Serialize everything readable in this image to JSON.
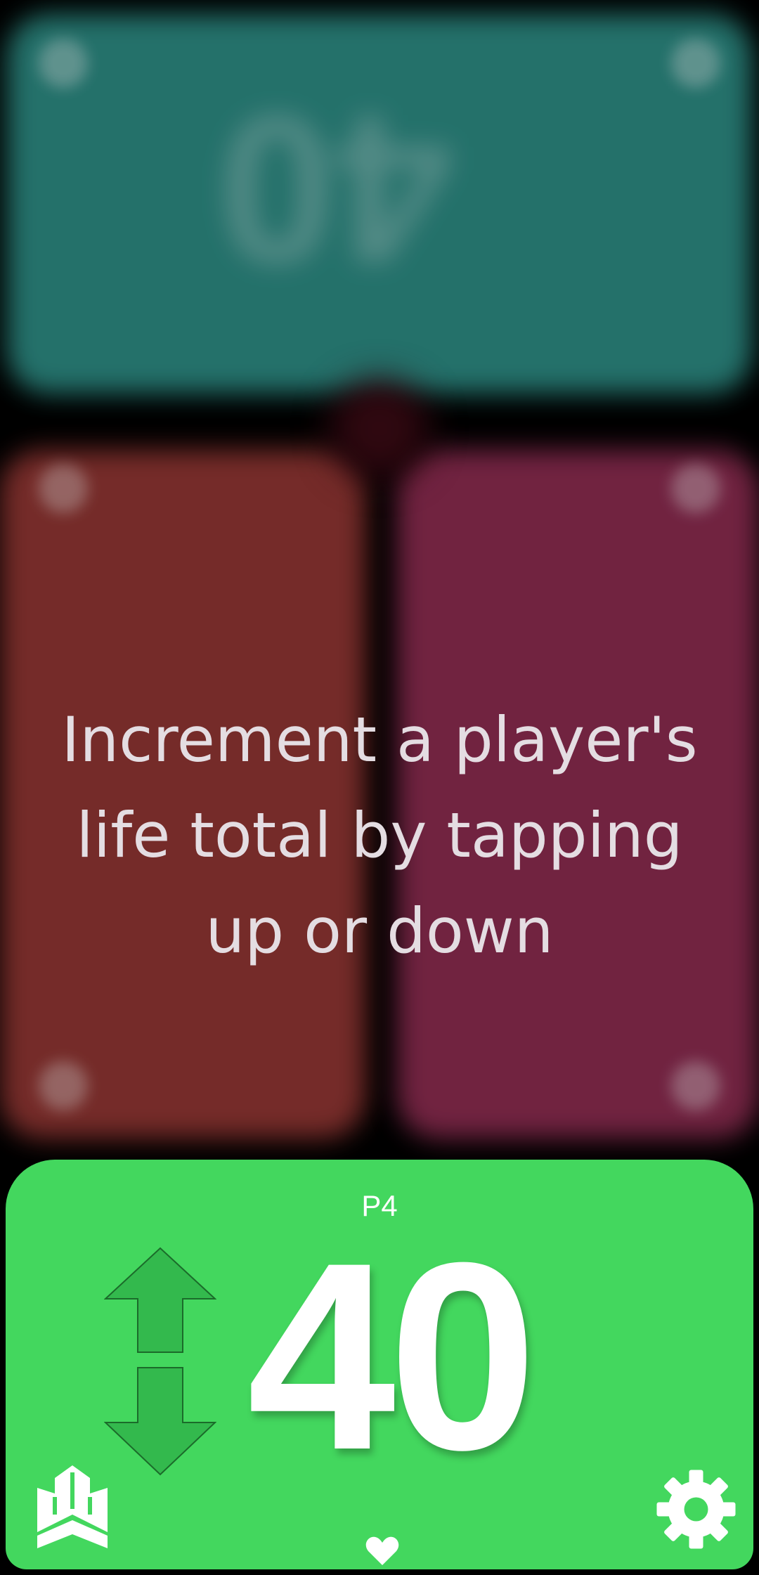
{
  "tutorial": {
    "hint": "Increment a player's life total by tapping up or down"
  },
  "players": {
    "top": {
      "life": "40",
      "color": "#2c8a82"
    },
    "left": {
      "color": "#8f3532"
    },
    "right": {
      "color": "#8a2b4f"
    }
  },
  "active_player": {
    "name": "P4",
    "life": "40",
    "color": "#43d75e"
  },
  "icons": {
    "increment": "arrow-up-icon",
    "decrement": "arrow-down-icon",
    "home": "castle-icon",
    "life": "heart-icon",
    "settings": "gear-icon"
  }
}
